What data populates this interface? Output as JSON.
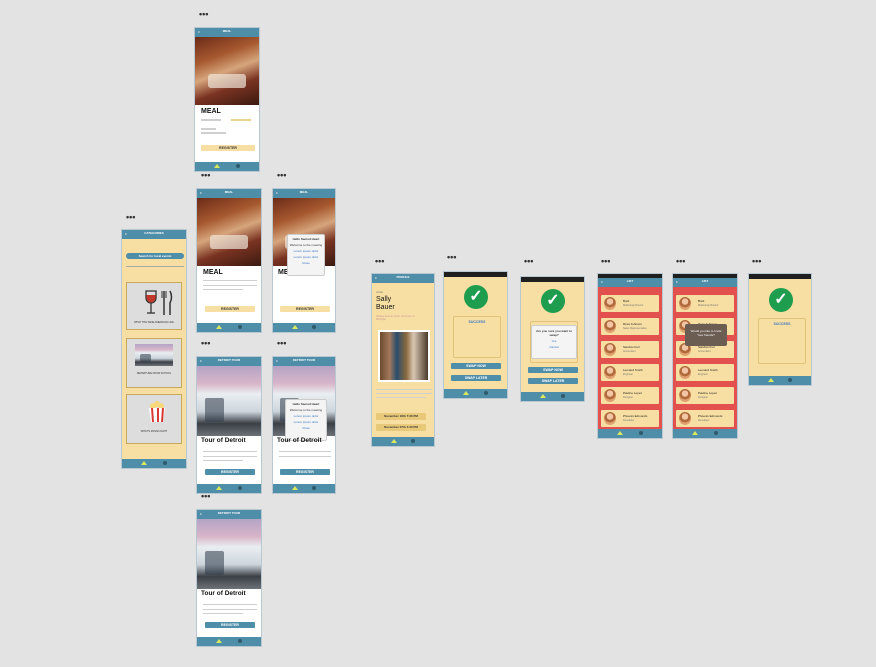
{
  "canvas": {
    "dots": "•••"
  },
  "screens": {
    "meal": {
      "title": "MEAL",
      "register": "REGISTER",
      "popup_title": "Hello Sacred Heart",
      "popup_sub": "Welcome to the meeting",
      "popup_opt1": "Lorem ipsum dolor",
      "popup_opt2": "Lorem ipsum dolor",
      "popup_close": "Close"
    },
    "events": {
      "header": "CATEGORIES",
      "search": "Search for local events",
      "cat1": "WHAT THE WINE AMERICAN LIFE",
      "cat2": "DEPARTURE FROM SCHOOL",
      "cat3": "WHAT'S MOVIE NIGHT"
    },
    "tour": {
      "header": "DETROIT TOUR",
      "title": "Tour of Detroit",
      "register": "REGISTER"
    },
    "profile": {
      "header": "PROFILE",
      "label": "Artist",
      "name_line1": "Sally",
      "name_line2": "Bauer",
      "about": "Visiting lecturer at the University of Michigan",
      "date1": "November 18th 7:30 PM",
      "date2": "November 27th 4:30 PM"
    },
    "success": {
      "label": "SUCCESS",
      "swap_now": "SWAP NOW",
      "swap_later": "SWAP LATER",
      "question": "Are you sure you want to swap?",
      "yes": "Yes",
      "no": "Cancel"
    },
    "list": {
      "header": "LIST",
      "people": [
        {
          "name": "Brett",
          "sub": "Marketing Director"
        },
        {
          "name": "Ross Johnson",
          "sub": "Sales Representative"
        },
        {
          "name": "Sandra Cruz",
          "sub": "Accountant"
        },
        {
          "name": "Leonard Smith",
          "sub": "Engineer"
        },
        {
          "name": "Pauline Lopez",
          "sub": "Designer"
        },
        {
          "name": "Phoenix Edmonds",
          "sub": "Developer"
        }
      ],
      "popup": "Would you like to Invite Your friends?"
    }
  }
}
